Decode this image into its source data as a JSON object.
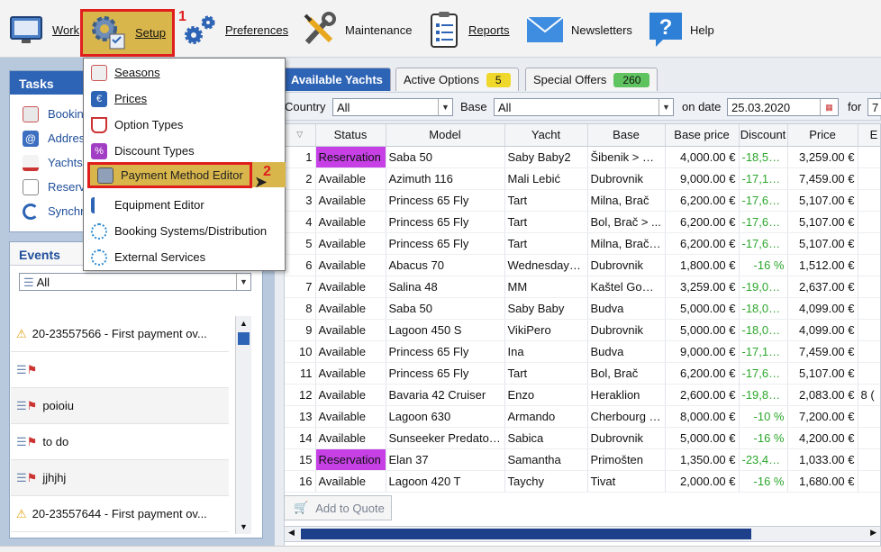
{
  "toolbar": {
    "work": "Work",
    "setup": "Setup",
    "preferences": "Preferences",
    "maintenance": "Maintenance",
    "reports": "Reports",
    "newsletters": "Newsletters",
    "help": "Help"
  },
  "markers": {
    "one": "1",
    "two": "2"
  },
  "tasks": {
    "title": "Tasks",
    "items": [
      "Bookin",
      "Addres",
      "Yachts",
      "Reserv",
      "Synchr"
    ]
  },
  "events": {
    "title": "Events",
    "filter": "All",
    "items": [
      "20-23557566 - First payment ov...",
      "",
      "poioiu",
      "to do",
      "jjhjhj",
      "20-23557644 - First payment ov..."
    ]
  },
  "setup_menu": {
    "items": [
      "Seasons",
      "Prices",
      "Option Types",
      "Discount Types",
      "Payment Method Editor",
      "Equipment Editor",
      "Booking Systems/Distribution",
      "External Services"
    ],
    "highlighted": "Payment Method Editor"
  },
  "tabs": {
    "available": "Available Yachts",
    "active_options": "Active Options",
    "active_options_count": "5",
    "special_offers": "Special Offers",
    "special_offers_count": "260"
  },
  "filters": {
    "country_label": "Country",
    "country_value": "All",
    "base_label": "Base",
    "base_value": "All",
    "date_label": "on date",
    "date_value": "25.03.2020",
    "for_label": "for",
    "for_value": "7"
  },
  "table": {
    "columns": [
      "Status",
      "Model",
      "Yacht",
      "Base",
      "Base price",
      "Discount",
      "Price",
      "E"
    ],
    "rows": [
      {
        "n": "1",
        "status": "Reservation",
        "model": "Saba 50",
        "yacht": "Saby Baby2",
        "base": "Šibenik > Pe...",
        "base_price": "4,000.00 €",
        "discount": "-18,52 ...",
        "price": "3,259.00 €",
        "extra": ""
      },
      {
        "n": "2",
        "status": "Available",
        "model": "Azimuth 116",
        "yacht": "Mali Lebić",
        "base": "Dubrovnik",
        "base_price": "9,000.00 €",
        "discount": "-17,12 ...",
        "price": "7,459.00 €",
        "extra": ""
      },
      {
        "n": "3",
        "status": "Available",
        "model": "Princess 65 Fly",
        "yacht": "Tart",
        "base": "Milna, Brač",
        "base_price": "6,200.00 €",
        "discount": "-17,63 ...",
        "price": "5,107.00 €",
        "extra": ""
      },
      {
        "n": "4",
        "status": "Available",
        "model": "Princess 65 Fly",
        "yacht": "Tart",
        "base": "Bol, Brač > ...",
        "base_price": "6,200.00 €",
        "discount": "-17,63 ...",
        "price": "5,107.00 €",
        "extra": ""
      },
      {
        "n": "5",
        "status": "Available",
        "model": "Princess 65 Fly",
        "yacht": "Tart",
        "base": "Milna, Brač ...",
        "base_price": "6,200.00 €",
        "discount": "-17,63 ...",
        "price": "5,107.00 €",
        "extra": ""
      },
      {
        "n": "6",
        "status": "Available",
        "model": "Abacus 70",
        "yacht": "Wednesday t...",
        "base": "Dubrovnik",
        "base_price": "1,800.00 €",
        "discount": "-16 %",
        "price": "1,512.00 €",
        "extra": ""
      },
      {
        "n": "7",
        "status": "Available",
        "model": "Salina 48",
        "yacht": "MM",
        "base": "Kaštel Gomi...",
        "base_price": "3,259.00 €",
        "discount": "-19,09 ...",
        "price": "2,637.00 €",
        "extra": ""
      },
      {
        "n": "8",
        "status": "Available",
        "model": "Saba 50",
        "yacht": "Saby Baby",
        "base": "Budva",
        "base_price": "5,000.00 €",
        "discount": "-18,02 ...",
        "price": "4,099.00 €",
        "extra": ""
      },
      {
        "n": "9",
        "status": "Available",
        "model": "Lagoon 450 S",
        "yacht": "VikiPero",
        "base": "Dubrovnik",
        "base_price": "5,000.00 €",
        "discount": "-18,02 ...",
        "price": "4,099.00 €",
        "extra": ""
      },
      {
        "n": "10",
        "status": "Available",
        "model": "Princess 65 Fly",
        "yacht": "Ina",
        "base": "Budva",
        "base_price": "9,000.00 €",
        "discount": "-17,12 ...",
        "price": "7,459.00 €",
        "extra": ""
      },
      {
        "n": "11",
        "status": "Available",
        "model": "Princess 65 Fly",
        "yacht": "Tart",
        "base": "Bol, Brač",
        "base_price": "6,200.00 €",
        "discount": "-17,63 ...",
        "price": "5,107.00 €",
        "extra": ""
      },
      {
        "n": "12",
        "status": "Available",
        "model": "Bavaria 42 Cruiser",
        "yacht": "Enzo",
        "base": "Heraklion",
        "base_price": "2,600.00 €",
        "discount": "-19,88 ...",
        "price": "2,083.00 €",
        "extra": "8 ("
      },
      {
        "n": "13",
        "status": "Available",
        "model": "Lagoon 630",
        "yacht": "Armando",
        "base": "Cherbourg - ...",
        "base_price": "8,000.00 €",
        "discount": "-10 %",
        "price": "7,200.00 €",
        "extra": ""
      },
      {
        "n": "14",
        "status": "Available",
        "model": "Sunseeker Predator ...",
        "yacht": "Sabica",
        "base": "Dubrovnik",
        "base_price": "5,000.00 €",
        "discount": "-16 %",
        "price": "4,200.00 €",
        "extra": ""
      },
      {
        "n": "15",
        "status": "Reservation",
        "model": "Elan 37",
        "yacht": "Samantha",
        "base": "Primošten",
        "base_price": "1,350.00 €",
        "discount": "-23,47 ...",
        "price": "1,033.00 €",
        "extra": ""
      },
      {
        "n": "16",
        "status": "Available",
        "model": "Lagoon 420 T",
        "yacht": "Taychy",
        "base": "Tivat",
        "base_price": "2,000.00 €",
        "discount": "-16 %",
        "price": "1,680.00 €",
        "extra": ""
      }
    ]
  },
  "add_to_quote": "Add to Quote",
  "colors": {
    "accent": "#2e64b5",
    "reservation": "#c640e6",
    "discount": "#2ca62c",
    "highlight": "#d9b64c",
    "callout": "#e01e1e"
  }
}
